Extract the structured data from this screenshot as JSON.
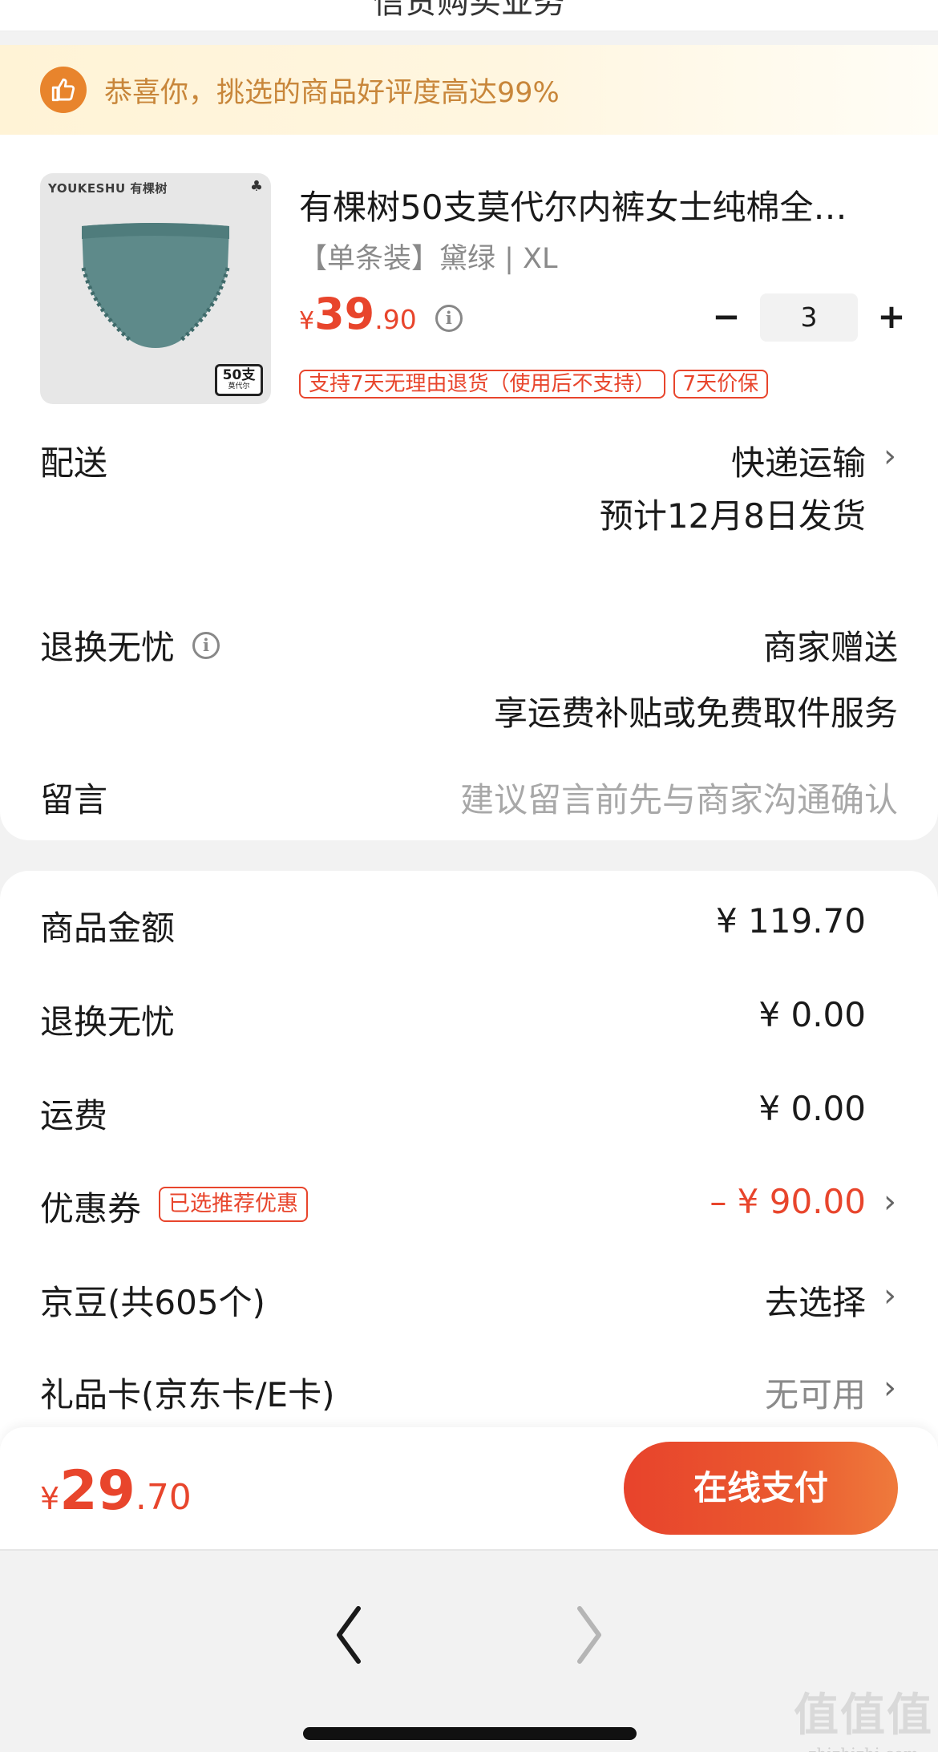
{
  "header": {
    "title": "信贷购买业务"
  },
  "banner": {
    "text": "恭喜你，挑选的商品好评度高达99%",
    "icon": "thumbs-up-icon"
  },
  "product": {
    "image_brand": "YOUKESHU 有棵树",
    "image_badge_main": "50支",
    "image_badge_sub": "莫代尔",
    "title": "有棵树50支莫代尔内裤女士纯棉全…",
    "spec": "【单条装】黛绿 | XL",
    "price_symbol": "¥",
    "price_int": "39",
    "price_dec": ".90",
    "quantity": "3",
    "minus": "−",
    "plus": "+",
    "tags": [
      "支持7天无理由退货（使用后不支持）",
      "7天价保"
    ]
  },
  "delivery": {
    "label": "配送",
    "method": "快递运输",
    "estimate": "预计12月8日发货"
  },
  "return_service": {
    "label": "退换无忧",
    "value": "商家赠送",
    "desc": "享运费补贴或免费取件服务"
  },
  "message": {
    "label": "留言",
    "placeholder": "建议留言前先与商家沟通确认"
  },
  "summary": {
    "goods_label": "商品金额",
    "goods_value": "¥ 119.70",
    "return_label": "退换无忧",
    "return_value": "¥ 0.00",
    "shipping_label": "运费",
    "shipping_value": "¥ 0.00",
    "coupon_label": "优惠券",
    "coupon_tag": "已选推荐优惠",
    "coupon_value": "– ¥ 90.00",
    "beans_label": "京豆(共605个)",
    "beans_value": "去选择",
    "giftcard_label": "礼品卡(京东卡/E卡)",
    "giftcard_value": "无可用"
  },
  "bottom": {
    "total_symbol": "¥",
    "total_int": "29",
    "total_dec": ".70",
    "pay_label": "在线支付"
  },
  "watermark": {
    "big": "值值值",
    "small": "zhizhizhi.com"
  },
  "colors": {
    "accent": "#e8452c",
    "banner_text": "#c8863a",
    "banner_icon": "#e8842c"
  }
}
